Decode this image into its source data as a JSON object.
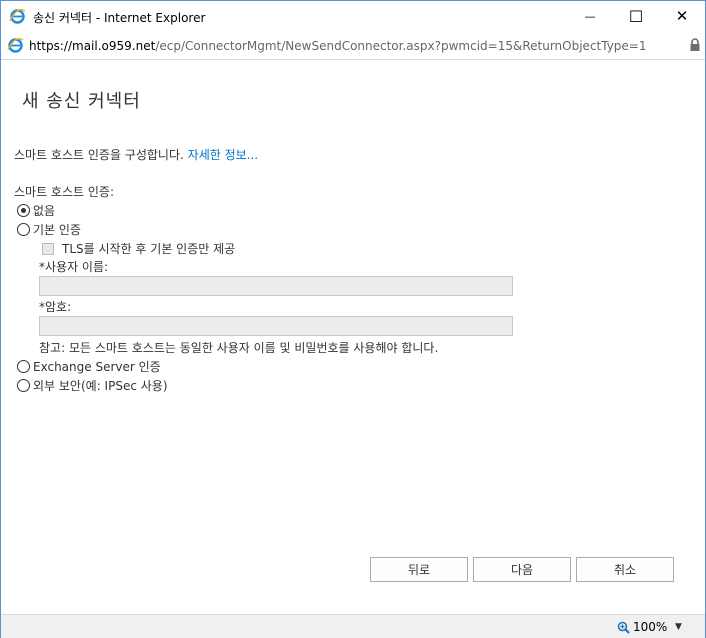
{
  "window": {
    "title": "송신 커넥터 - Internet Explorer",
    "minimize_glyph": "—",
    "maximize_glyph": "☐",
    "close_glyph": "✕"
  },
  "address": {
    "prefix": "https://mail.",
    "host": "o959.net",
    "path": "/ecp/ConnectorMgmt/NewSendConnector.aspx?pwmcid=15&ReturnObjectType=1"
  },
  "page": {
    "title": "새 송신 커넥터",
    "intro_text": "스마트 호스트 인증을 구성합니다.",
    "intro_link": "자세한 정보...",
    "section_label": "스마트 호스트 인증:",
    "options": {
      "none": "없음",
      "basic": "기본 인증",
      "tls_only": "TLS를 시작한 후 기본 인증만 제공",
      "username_label": "*사용자 이름:",
      "password_label": "*암호:",
      "note": "참고: 모든 스마트 호스트는 동일한 사용자 이름 및 비밀번호를 사용해야 합니다.",
      "exchange": "Exchange Server 인증",
      "external": "외부 보안(예: IPSec 사용)"
    },
    "selected_option": "none"
  },
  "buttons": {
    "back": "뒤로",
    "next": "다음",
    "cancel": "취소"
  },
  "status": {
    "zoom": "100%"
  },
  "colors": {
    "link": "#0072c6",
    "window_border": "#5a8fd0"
  }
}
